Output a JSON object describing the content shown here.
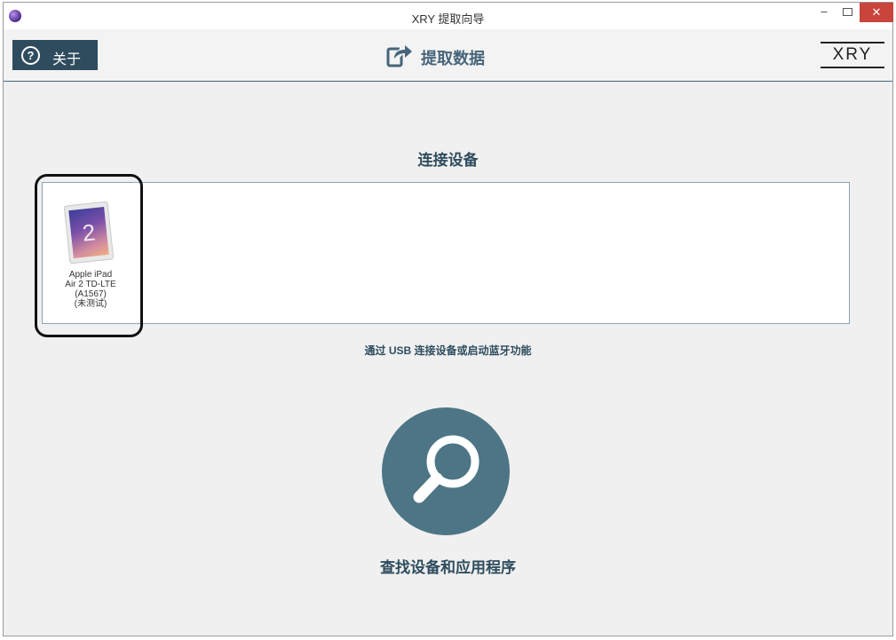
{
  "window": {
    "title": "XRY 提取向导",
    "minimize": "–",
    "close": "✕"
  },
  "header": {
    "about_label": "关于",
    "about_icon": "?",
    "extract_label": "提取数据",
    "logo": "XRY"
  },
  "connect": {
    "section_title": "连接设备",
    "devices": [
      {
        "screen_text": "2",
        "label_lines": [
          "Apple iPad",
          "Air 2 TD-LTE",
          "(A1567)",
          "(未测试)"
        ]
      }
    ],
    "hint": "通过 USB 连接设备或启动蓝牙功能"
  },
  "search": {
    "label": "查找设备和应用程序"
  },
  "colors": {
    "accent": "#2e4c5e",
    "search_button": "#4d7586",
    "close_button": "#c9443a"
  }
}
